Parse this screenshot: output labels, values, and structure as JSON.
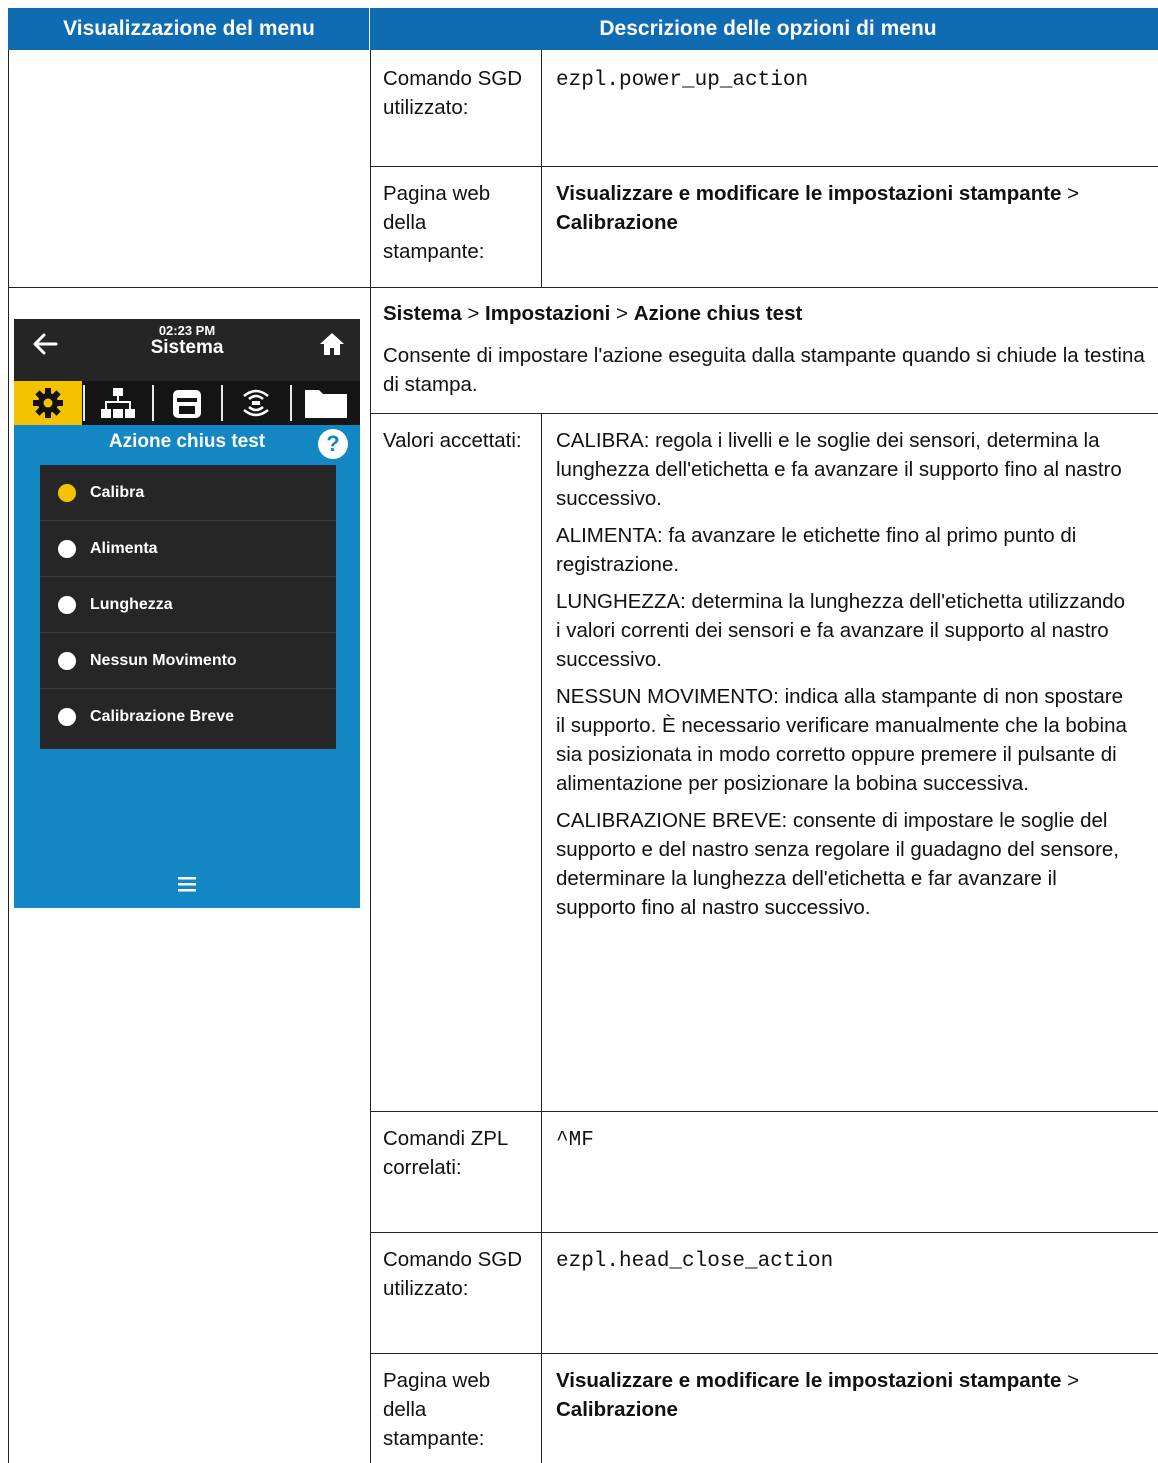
{
  "header": {
    "left": "Visualizzazione del menu",
    "right": "Descrizione delle opzioni di menu"
  },
  "top_rows": [
    {
      "label": "Comando SGD utilizzato:",
      "value": "ezpl.power_up_action"
    },
    {
      "label": "Pagina web della stampante:",
      "value_bold_1": "Visualizzare e modificare le impostazioni stampante",
      "sep": ">",
      "value_bold_2": "Calibrazione"
    }
  ],
  "section": {
    "path": [
      "Sistema",
      "Impostazioni",
      "Azione chius test"
    ],
    "path_sep": ">",
    "description": "Consente di impostare l'azione eseguita dalla stampante quando si chiude la testina di stampa."
  },
  "accepted_values": {
    "label": "Valori accettati:",
    "items": [
      "CALIBRA: regola i livelli e le soglie dei sensori, determina la lunghezza dell'etichetta e fa avanzare il supporto fino al nastro successivo.",
      "ALIMENTA: fa avanzare le etichette fino al primo punto di registrazione.",
      "LUNGHEZZA: determina la lunghezza dell'etichetta utilizzando i valori correnti dei sensori e fa avanzare il supporto al nastro successivo.",
      "NESSUN MOVIMENTO: indica alla stampante di non spostare il supporto. È necessario verificare manualmente che la bobina sia posizionata in modo corretto oppure premere il pulsante di alimentazione per posizionare la bobina successiva.",
      "CALIBRAZIONE BREVE: consente di impostare le soglie del supporto e del nastro senza regolare il guadagno del sensore, determinare la lunghezza dell'etichetta e far avanzare il supporto fino al nastro successivo."
    ]
  },
  "bottom_rows": [
    {
      "label": "Comandi ZPL correlati:",
      "value": "^MF"
    },
    {
      "label": "Comando SGD utilizzato:",
      "value": "ezpl.head_close_action"
    },
    {
      "label": "Pagina web della stampante:",
      "value_bold_1": "Visualizzare e modificare le impostazioni stampante",
      "sep": ">",
      "value_bold_2": "Calibrazione"
    }
  ],
  "device": {
    "time": "02:23 PM",
    "title": "Sistema",
    "heading": "Azione chius test",
    "help": "?",
    "tabs": [
      "gear-icon",
      "network-icon",
      "printer-icon",
      "wireless-icon",
      "folder-icon"
    ],
    "selected_tab": 0,
    "options": [
      "Calibra",
      "Alimenta",
      "Lunghezza",
      "Nessun Movimento",
      "Calibrazione Breve"
    ],
    "selected_option": 0,
    "colors": {
      "background": "#1287c4",
      "bar": "#252525",
      "accent": "#f5c200",
      "list": "#262626"
    }
  }
}
